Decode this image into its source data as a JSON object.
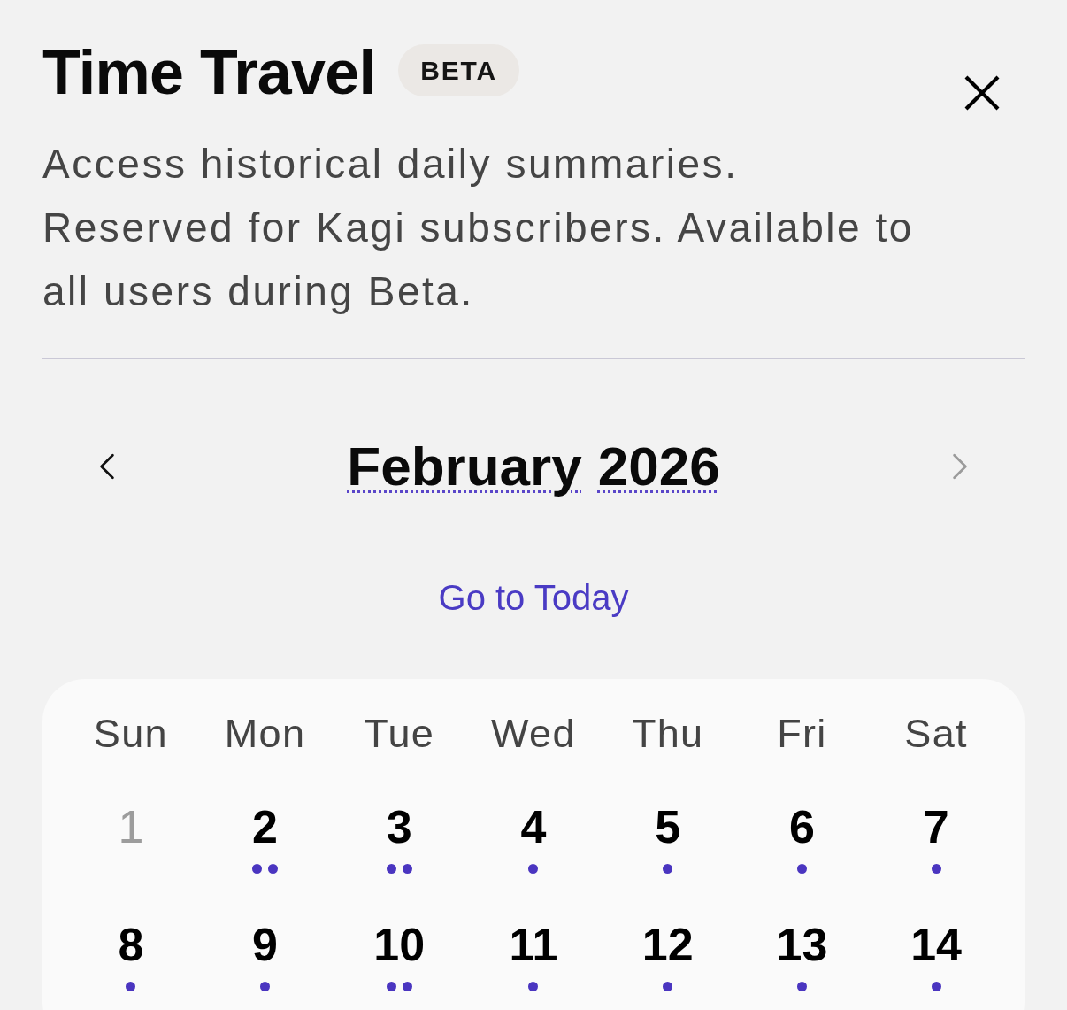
{
  "header": {
    "title": "Time Travel",
    "badge": "BETA",
    "paragraphs": [
      "Access historical daily summaries.",
      "Reserved for Kagi subscribers. Available to all users during Beta."
    ]
  },
  "month_nav": {
    "prev": {
      "disabled": false
    },
    "month": "February",
    "year": "2026",
    "next": {
      "disabled": true
    }
  },
  "go_to_today": "Go to Today",
  "calendar": {
    "weekdays": [
      "Sun",
      "Mon",
      "Tue",
      "Wed",
      "Thu",
      "Fri",
      "Sat"
    ],
    "days": [
      {
        "label": "1",
        "disabled": true
      },
      {
        "label": "2",
        "disabled": false,
        "markers": [
          {
            "kind": "dot"
          },
          {
            "kind": "dot"
          }
        ]
      },
      {
        "label": "3",
        "disabled": false,
        "markers": [
          {
            "kind": "dot"
          },
          {
            "kind": "dot"
          }
        ]
      },
      {
        "label": "4",
        "disabled": false,
        "markers": [
          {
            "kind": "dot"
          }
        ]
      },
      {
        "label": "5",
        "disabled": false,
        "markers": [
          {
            "kind": "dot"
          }
        ]
      },
      {
        "label": "6",
        "disabled": false,
        "markers": [
          {
            "kind": "dot"
          }
        ]
      },
      {
        "label": "7",
        "disabled": false,
        "markers": [
          {
            "kind": "dot"
          }
        ]
      },
      {
        "label": "8",
        "disabled": false,
        "markers": [
          {
            "kind": "dot"
          }
        ]
      },
      {
        "label": "9",
        "disabled": false,
        "markers": [
          {
            "kind": "dot"
          }
        ]
      },
      {
        "label": "10",
        "disabled": false,
        "markers": [
          {
            "kind": "dot"
          },
          {
            "kind": "dot"
          }
        ]
      },
      {
        "label": "11",
        "disabled": false,
        "markers": [
          {
            "kind": "dot"
          }
        ]
      },
      {
        "label": "12",
        "disabled": false,
        "markers": [
          {
            "kind": "dot"
          }
        ]
      },
      {
        "label": "13",
        "disabled": false,
        "markers": [
          {
            "kind": "dot"
          }
        ]
      },
      {
        "label": "14",
        "disabled": false,
        "markers": [
          {
            "kind": "dot"
          }
        ]
      }
    ]
  }
}
